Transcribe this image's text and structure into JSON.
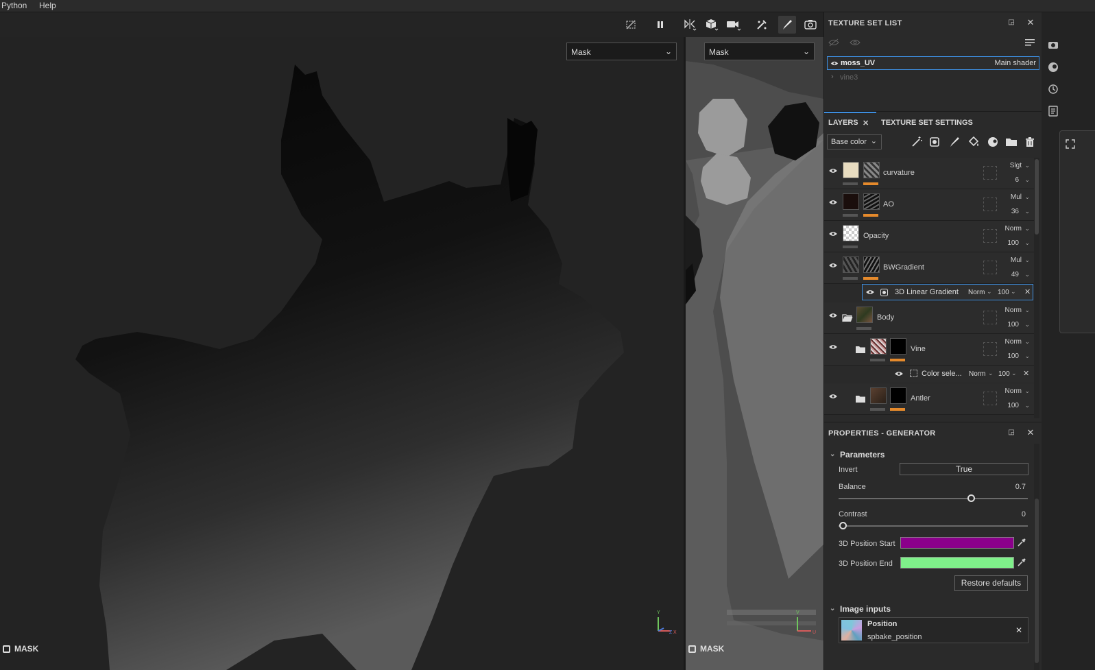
{
  "menubar": {
    "items": [
      "Python",
      "Help"
    ]
  },
  "toolbar": {
    "icons": [
      "hide-icon",
      "pause-icon",
      "symmetry-icon",
      "cube-icon",
      "camera-icon",
      "brush-settings-icon",
      "paint-brush-icon",
      "screenshot-icon"
    ]
  },
  "viewport3d": {
    "channel": "Mask",
    "label": "MASK",
    "axis_labels": {
      "y": "Y",
      "z": "Z",
      "x": "X"
    }
  },
  "viewport2d": {
    "channel": "Mask",
    "label": "MASK",
    "axis_labels": {
      "v": "V",
      "u": "U"
    }
  },
  "texture_set_list": {
    "title": "TEXTURE SET LIST",
    "sets": [
      {
        "name": "moss_UV",
        "shader": "Main shader",
        "selected": true
      },
      {
        "name": "vine3",
        "shader": "",
        "selected": false
      }
    ]
  },
  "layers_panel": {
    "tabs": [
      "LAYERS",
      "TEXTURE SET SETTINGS"
    ],
    "channel": "Base color",
    "layers": [
      {
        "name": "curvature",
        "blend": "Slgt",
        "opacity": "6"
      },
      {
        "name": "AO",
        "blend": "Mul",
        "opacity": "36"
      },
      {
        "name": "Opacity",
        "blend": "Norm",
        "opacity": "100"
      },
      {
        "name": "BWGradient",
        "blend": "Mul",
        "opacity": "49"
      },
      {
        "name": "Body",
        "blend": "Norm",
        "opacity": "100"
      },
      {
        "name": "Vine",
        "blend": "Norm",
        "opacity": "100"
      },
      {
        "name": "Antler",
        "blend": "Norm",
        "opacity": "100"
      }
    ],
    "effects": [
      {
        "name": "3D Linear Gradient",
        "blend": "Norm",
        "opacity": "100"
      },
      {
        "name": "Color sele...",
        "blend": "Norm",
        "opacity": "100"
      }
    ]
  },
  "properties": {
    "title": "PROPERTIES - GENERATOR",
    "parameters_title": "Parameters",
    "invert_label": "Invert",
    "invert_value": "True",
    "balance_label": "Balance",
    "balance_value": "0.7",
    "balance_fraction": 0.7,
    "contrast_label": "Contrast",
    "contrast_value": "0",
    "contrast_fraction": 0,
    "pos_start_label": "3D Position Start",
    "pos_start_color": "#8b008b",
    "pos_end_label": "3D Position End",
    "pos_end_color": "#7ff08a",
    "restore_label": "Restore defaults",
    "image_inputs_title": "Image inputs",
    "input_name": "Position",
    "input_source": "spbake_position"
  },
  "colors": {
    "accent": "#3d8ee0",
    "orange": "#e58a2c"
  }
}
